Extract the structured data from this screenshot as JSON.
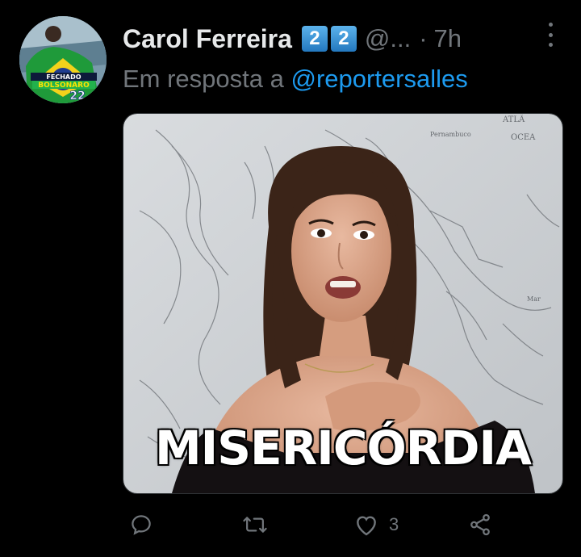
{
  "tweet": {
    "author_name": "Carol Ferreira",
    "badges": [
      "2",
      "2"
    ],
    "handle": "@...",
    "separator": "·",
    "time": "7h",
    "reply_prefix": "Em resposta a ",
    "reply_mention": "@reportersalles",
    "avatar_text": {
      "line1": "FECHADO",
      "line2": "BOLSONARO",
      "line3": "22"
    },
    "media": {
      "caption": "MISERICÓRDIA",
      "map_labels": {
        "atlantic": "ATLÂ",
        "ocean": "OCEA",
        "place1": "Pernambuco",
        "place2": "Mar"
      }
    },
    "actions": {
      "like_count": "3"
    }
  },
  "colors": {
    "background": "#000000",
    "text": "#e7e9ea",
    "secondary": "#71767b",
    "link": "#1d9bf0",
    "badge": "#2f8fd0"
  },
  "icons": [
    "more-icon",
    "reply-icon",
    "retweet-icon",
    "like-icon",
    "share-icon"
  ]
}
